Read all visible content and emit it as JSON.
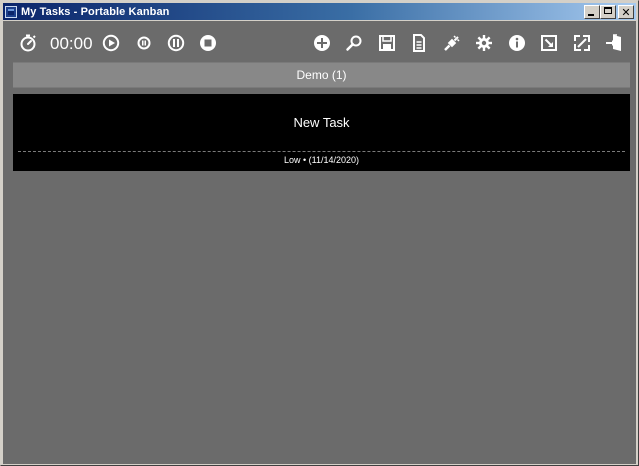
{
  "window": {
    "title": "My Tasks - Portable Kanban"
  },
  "toolbar": {
    "timer": "00:00",
    "left_icons": [
      "stopwatch-icon",
      "play-icon",
      "pause-small-icon",
      "pause-icon",
      "stop-icon"
    ],
    "right_icons": [
      "add-icon",
      "search-icon",
      "save-icon",
      "document-icon",
      "plugin-icon",
      "settings-icon",
      "info-icon",
      "minimize-to-tray-icon",
      "fullscreen-icon",
      "exit-icon"
    ]
  },
  "column": {
    "title": "Demo (1)"
  },
  "tasks": [
    {
      "title": "New Task",
      "meta": "Low • (11/14/2020)"
    }
  ],
  "colors": {
    "background": "#6b6b6b",
    "column_header": "#888888",
    "card": "#000000",
    "text": "#ffffff"
  }
}
